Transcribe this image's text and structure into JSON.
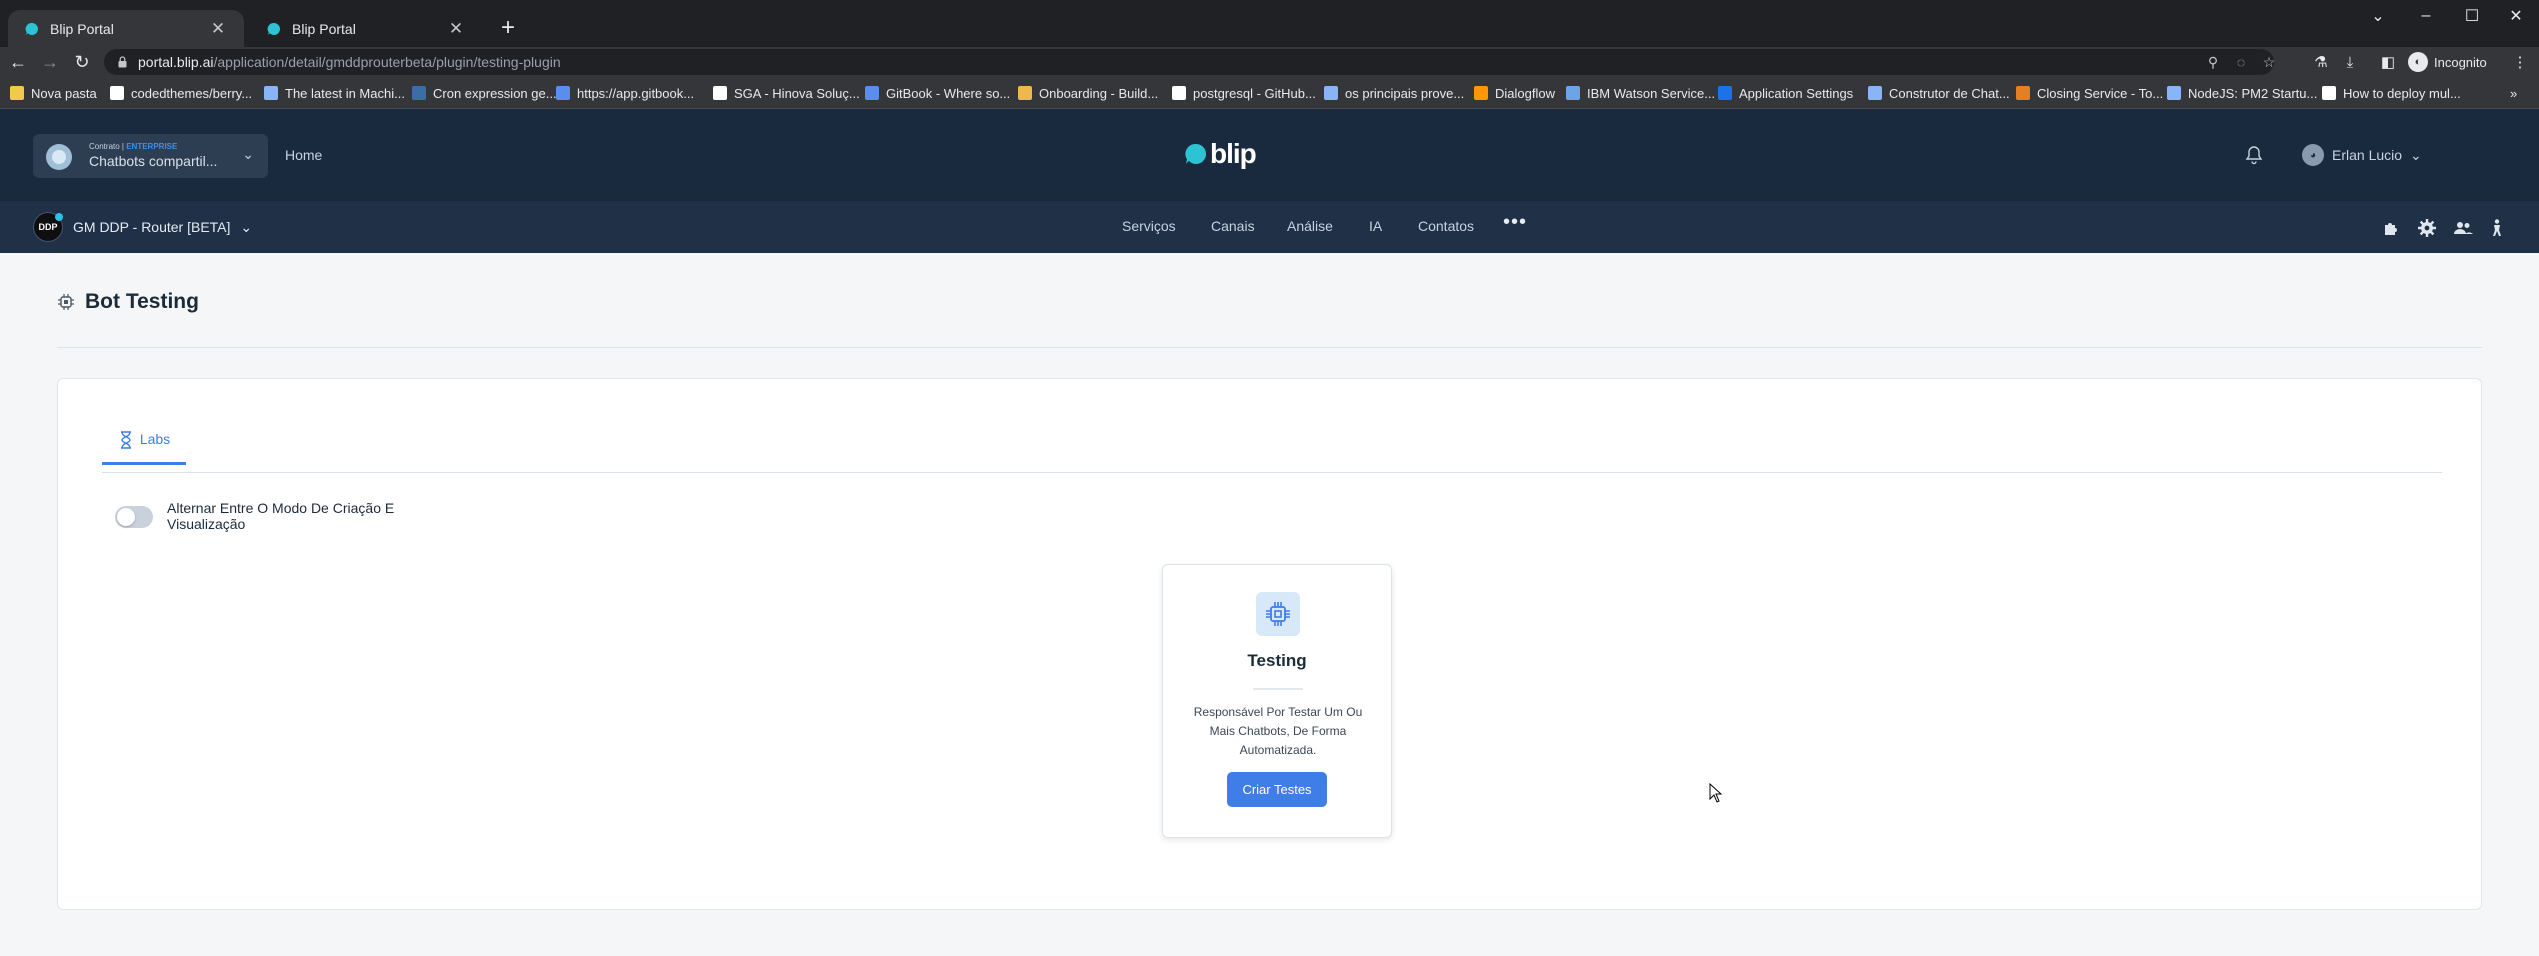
{
  "browser": {
    "tabs": [
      {
        "title": "Blip Portal",
        "active": true
      },
      {
        "title": "Blip Portal",
        "active": false
      }
    ],
    "url": {
      "host": "portal.blip.ai",
      "path": "/application/detail/gmddprouterbeta/plugin/testing-plugin"
    },
    "profile_label": "Incognito",
    "bookmarks": [
      {
        "label": "Nova pasta",
        "icon": "folder-icon"
      },
      {
        "label": "codedthemes/berry...",
        "icon": "github-icon"
      },
      {
        "label": "The latest in Machi...",
        "icon": "page-icon"
      },
      {
        "label": "Cron expression ge...",
        "icon": "c-icon"
      },
      {
        "label": "https://app.gitbook...",
        "icon": "gitbook-icon"
      },
      {
        "label": "SGA - Hinova Soluç...",
        "icon": "circle-icon"
      },
      {
        "label": "GitBook - Where so...",
        "icon": "gitbook-icon"
      },
      {
        "label": "Onboarding - Build...",
        "icon": "build-icon"
      },
      {
        "label": "postgresql - GitHub...",
        "icon": "github-icon"
      },
      {
        "label": "os principais prove...",
        "icon": "page-icon"
      },
      {
        "label": "Dialogflow",
        "icon": "dialogflow-icon"
      },
      {
        "label": "IBM Watson Service...",
        "icon": "cloud-icon"
      },
      {
        "label": "Application Settings",
        "icon": "info-icon"
      },
      {
        "label": "Construtor de Chat...",
        "icon": "page-icon"
      },
      {
        "label": "Closing Service - To...",
        "icon": "closing-icon"
      },
      {
        "label": "NodeJS: PM2 Startu...",
        "icon": "page-icon"
      },
      {
        "label": "How to deploy mul...",
        "icon": "medium-icon"
      }
    ]
  },
  "header": {
    "contract_label": "Contrato |",
    "contract_plan": "ENTERPRISE",
    "contract_name": "Chatbots compartil...",
    "home": "Home",
    "logo_text": "blip",
    "user_name": "Erlan Lucio"
  },
  "subnav": {
    "bot_initials": "DDP",
    "bot_name": "GM DDP - Router [BETA]",
    "menu": [
      "Serviços",
      "Canais",
      "Análise",
      "IA",
      "Contatos"
    ],
    "more": "•••"
  },
  "page": {
    "title": "Bot Testing",
    "tab_label": "Labs",
    "toggle_label": "Alternar Entre O Modo De Criação E Visualização",
    "toggle_on": false,
    "card": {
      "title": "Testing",
      "description": "Responsável Por Testar Um Ou Mais Chatbots, De Forma Automatizada.",
      "button": "Criar Testes"
    }
  },
  "colors": {
    "header_bg": "#1a2a3e",
    "subnav_bg": "#1f3047",
    "accent": "#3f7de8",
    "page_bg": "#f4f6f8"
  }
}
